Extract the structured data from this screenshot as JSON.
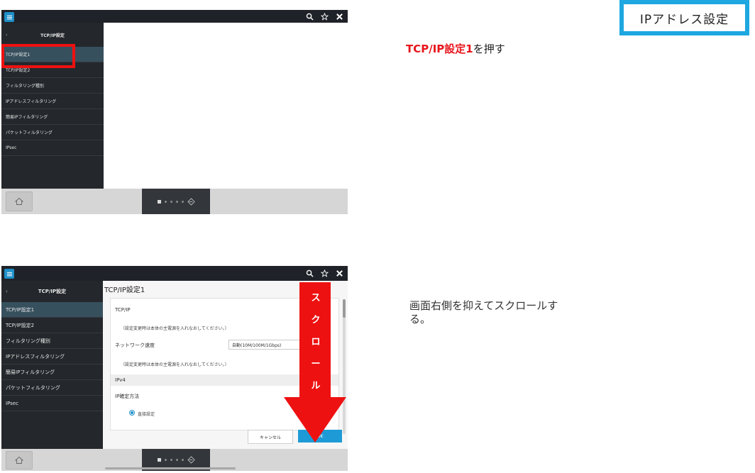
{
  "title_badge": "IPアドレス設定",
  "instruction1": {
    "highlight": "TCP/IP設定1",
    "rest": "を押す"
  },
  "instruction2": "画面右側を抑えてスクロールする。",
  "top_screen": {
    "sidebar_title": "TCP/IP設定",
    "back": "‹",
    "items": [
      "TCP/IP設定1",
      "TCP/IP設定2",
      "フィルタリング種別",
      "IPアドレスフィルタリング",
      "簡易IPフィルタリング",
      "パケットフィルタリング",
      "IPsec"
    ]
  },
  "bottom_screen": {
    "sidebar_title": "TCP/IP設定",
    "back": "‹",
    "items": [
      "TCP/IP設定1",
      "TCP/IP設定2",
      "フィルタリング種別",
      "IPアドレスフィルタリング",
      "簡易IPフィルタリング",
      "パケットフィルタリング",
      "IPsec"
    ],
    "content_title": "TCP/IP設定1",
    "tcpip_label": "TCP/IP",
    "note1": "（設定変更時は本体の主電源を入れなおしてください。）",
    "network_speed_label": "ネットワーク速度",
    "network_speed_value": "自動(10M/100M/1Gbps)",
    "note2": "（設定変更時は本体の主電源を入れなおしてください。）",
    "ipv4": "IPv4",
    "ip_method_label": "IP確定方法",
    "radio_label": "直接設定",
    "cancel": "キャンセル",
    "ok": "OK"
  },
  "scroll_arrow_chars": [
    "ス",
    "ク",
    "ロ",
    "ー",
    "ル"
  ],
  "colors": {
    "accent": "#1e9bd7",
    "highlight_red": "#e8141b",
    "title_border": "#1ea7e0",
    "arrow_red": "#ee1111"
  }
}
